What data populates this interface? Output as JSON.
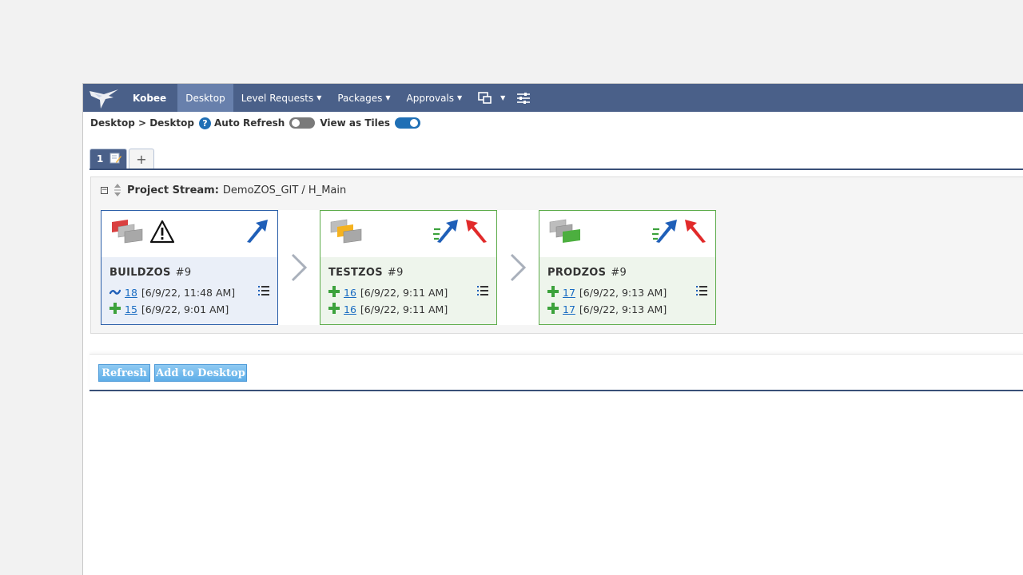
{
  "navbar": {
    "brand": "Kobee",
    "items": [
      {
        "label": "Desktop",
        "active": true
      },
      {
        "label": "Level Requests",
        "caret": true
      },
      {
        "label": "Packages",
        "caret": true
      },
      {
        "label": "Approvals",
        "caret": true
      }
    ],
    "bg_color": "#4a6089",
    "active_color": "#6880ac"
  },
  "breadcrumb": {
    "text": "Desktop > Desktop",
    "help": "?",
    "auto_refresh_label": "Auto Refresh",
    "auto_refresh_on": false,
    "tiles_label": "View as Tiles",
    "tiles_on": true
  },
  "tabs": {
    "active_label": "1",
    "add_label": "+"
  },
  "stream": {
    "prefix": "Project Stream:",
    "name": "DemoZOS_GIT / H_Main",
    "levels": [
      {
        "name": "BUILDZOS",
        "number": "#9",
        "line1": {
          "icon": "build-wave-icon",
          "link": "18",
          "date": "[6/9/22, 11:48 AM]"
        },
        "line2": {
          "icon": "plus-icon",
          "link": "15",
          "date": "[6/9/22, 9:01 AM]"
        },
        "stack_color": "#d94040",
        "border": "#2a5ea8"
      },
      {
        "name": "TESTZOS",
        "number": "#9",
        "line1": {
          "icon": "plus-icon",
          "link": "16",
          "date": "[6/9/22, 9:11 AM]"
        },
        "line2": {
          "icon": "plus-icon",
          "link": "16",
          "date": "[6/9/22, 9:11 AM]"
        },
        "stack_color": "#f5b21f",
        "border": "#5cab4a"
      },
      {
        "name": "PRODZOS",
        "number": "#9",
        "line1": {
          "icon": "plus-icon",
          "link": "17",
          "date": "[6/9/22, 9:13 AM]"
        },
        "line2": {
          "icon": "plus-icon",
          "link": "17",
          "date": "[6/9/22, 9:13 AM]"
        },
        "stack_color": "#4caf3f",
        "border": "#5cab4a"
      }
    ]
  },
  "buttons": {
    "refresh": "Refresh",
    "add_to_desktop": "Add to Desktop"
  }
}
